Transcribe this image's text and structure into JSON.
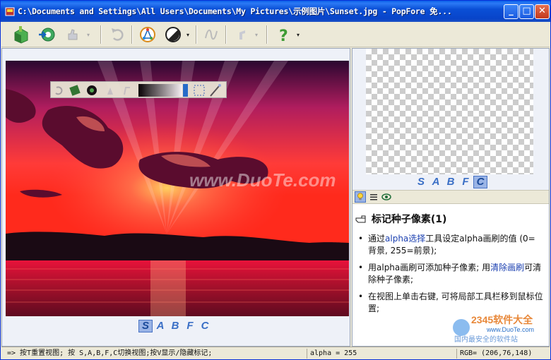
{
  "window": {
    "title": "C:\\Documents and Settings\\All Users\\Documents\\My Pictures\\示例图片\\Sunset.jpg - PopFore 免...",
    "min_label": "_",
    "max_label": "□",
    "close_label": "✕"
  },
  "toolbar": {
    "dropdown_arrow": "▾"
  },
  "left_panel": {
    "image_alt": "Sunset",
    "watermark": "www.DuoTe.com",
    "view_tabs": [
      "S",
      "A",
      "B",
      "F",
      "C"
    ],
    "active_tab": "S"
  },
  "right_panel": {
    "view_tabs": [
      "S",
      "A",
      "B",
      "F",
      "C"
    ],
    "active_tab": "C",
    "help_title": "标记种子像素(1)",
    "help_items": [
      {
        "pre": "通过",
        "link": "alpha选择",
        "post": "工具设定alpha画刷的值 (0=背景, 255=前景);"
      },
      {
        "pre": "用alpha画刷可添加种子像素; 用",
        "link": "清除画刷",
        "post": "可清除种子像素;"
      },
      {
        "pre": "在视图上单击右键, 可将局部工具栏移到鼠标位置;",
        "link": "",
        "post": ""
      }
    ],
    "logo_text": "2345软件大全",
    "logo_url": "www.DuoTe.com",
    "logo_caption": "国内最安全的软件站"
  },
  "status": {
    "hint": "=> 按T重置视图; 按 S,A,B,F,C切换视图;按V显示/隐藏标记;",
    "alpha": "alpha = 255",
    "rgb": "RGB= (206,76,148)"
  },
  "colors": {
    "accent": "#3a6fc6",
    "link": "#1a3fb0",
    "sky_top": "#3a0a3c",
    "sun": "#ff3a2a"
  }
}
